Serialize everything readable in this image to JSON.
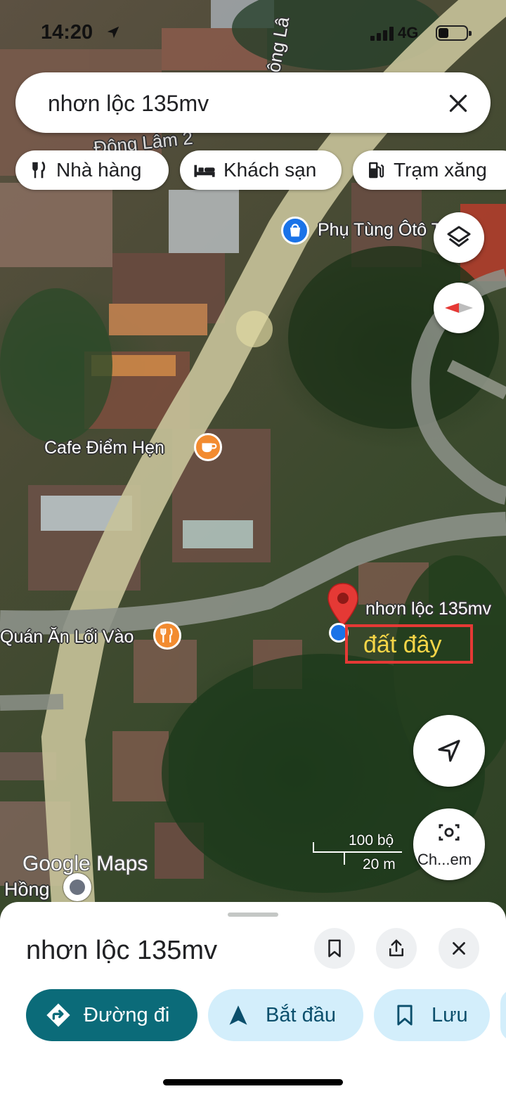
{
  "status_bar": {
    "time": "14:20",
    "network": "4G"
  },
  "search": {
    "query": "nhơn lộc 135mv"
  },
  "chips": [
    {
      "label": "Nhà hàng",
      "icon": "fork-knife-icon"
    },
    {
      "label": "Khách sạn",
      "icon": "bed-icon"
    },
    {
      "label": "Trạm xăng",
      "icon": "fuel-icon"
    }
  ],
  "map": {
    "street_label": "Đông Lâm 2",
    "street_label_2": "ông Lâ",
    "pois": [
      {
        "name": "Phụ Tùng Ôtô Tài",
        "icon": "shopping-bag-icon",
        "color": "#1a73e8"
      },
      {
        "name": "Cafe Điểm Hẹn",
        "icon": "coffee-icon",
        "color": "#f28b30"
      },
      {
        "name": "Quán Ăn Lối Vào",
        "icon": "restaurant-icon",
        "color": "#f28b30"
      }
    ],
    "pin_label": "nhơn lộc 135mv",
    "annotation": "đất đây",
    "bottom_label": "Hồng",
    "scale": {
      "imperial": "100 bộ",
      "metric": "20 m"
    },
    "attribution": "Google Maps",
    "streetview_label": "Ch...em"
  },
  "sheet": {
    "title": "nhơn lộc 135mv",
    "actions": [
      {
        "label": "Đường đi",
        "icon": "directions-icon",
        "primary": true
      },
      {
        "label": "Bắt đầu",
        "icon": "navigation-arrow-icon",
        "primary": false
      },
      {
        "label": "Lưu",
        "icon": "bookmark-icon",
        "primary": false
      }
    ]
  },
  "colors": {
    "primary": "#0b6b79",
    "chip_blue": "#d3eefb",
    "pin_red": "#e53935"
  }
}
